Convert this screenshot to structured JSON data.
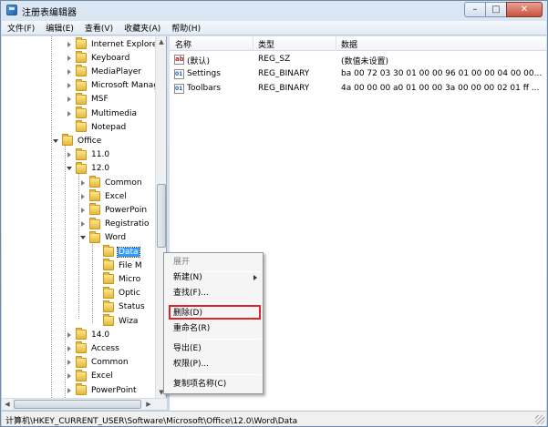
{
  "window": {
    "title": "注册表编辑器",
    "controls": {
      "minimize": "–",
      "maximize": "□",
      "close": "✕"
    }
  },
  "menubar": [
    "文件(F)",
    "编辑(E)",
    "查看(V)",
    "收藏夹(A)",
    "帮助(H)"
  ],
  "tree": {
    "rows": [
      {
        "label": "Internet Explorer",
        "twisty": "closed"
      },
      {
        "label": "Keyboard",
        "twisty": "closed"
      },
      {
        "label": "MediaPlayer",
        "twisty": "closed"
      },
      {
        "label": "Microsoft Manag",
        "twisty": "closed"
      },
      {
        "label": "MSF",
        "twisty": "closed"
      },
      {
        "label": "Multimedia",
        "twisty": "closed"
      },
      {
        "label": "Notepad",
        "twisty": "none"
      },
      {
        "label": "Office",
        "twisty": "open"
      },
      {
        "label": "11.0",
        "twisty": "closed"
      },
      {
        "label": "12.0",
        "twisty": "open"
      },
      {
        "label": "Common",
        "twisty": "closed"
      },
      {
        "label": "Excel",
        "twisty": "closed"
      },
      {
        "label": "PowerPoin",
        "twisty": "closed"
      },
      {
        "label": "Registratio",
        "twisty": "closed"
      },
      {
        "label": "Word",
        "twisty": "open"
      },
      {
        "label": "Data",
        "twisty": "none",
        "selected": true
      },
      {
        "label": "File M",
        "twisty": "none"
      },
      {
        "label": "Micro",
        "twisty": "none"
      },
      {
        "label": "Optic",
        "twisty": "none"
      },
      {
        "label": "Status",
        "twisty": "none"
      },
      {
        "label": "Wiza",
        "twisty": "none"
      },
      {
        "label": "14.0",
        "twisty": "closed"
      },
      {
        "label": "Access",
        "twisty": "closed"
      },
      {
        "label": "Common",
        "twisty": "closed"
      },
      {
        "label": "Excel",
        "twisty": "closed"
      },
      {
        "label": "PowerPoint",
        "twisty": "closed"
      }
    ]
  },
  "list": {
    "columns": [
      "名称",
      "类型",
      "数据"
    ],
    "rows": [
      {
        "icon": "ab",
        "name": "(默认)",
        "type": "REG_SZ",
        "data": "(数值未设置)"
      },
      {
        "icon": "bin",
        "name": "Settings",
        "type": "REG_BINARY",
        "data": "ba 00 72 03 30 01 00 00 96 01 00 00 04 00 00..."
      },
      {
        "icon": "bin",
        "name": "Toolbars",
        "type": "REG_BINARY",
        "data": "4a 00 00 00 a0 01 00 00 3a 00 00 00 02 01 ff ..."
      }
    ]
  },
  "context_menu": {
    "items": [
      {
        "label": "展开",
        "disabled": true
      },
      {
        "label": "新建(N)",
        "submenu": true
      },
      {
        "label": "查找(F)..."
      },
      {
        "label": "删除(D)",
        "highlighted": true
      },
      {
        "label": "重命名(R)"
      },
      {
        "label": "导出(E)"
      },
      {
        "label": "权限(P)..."
      },
      {
        "label": "复制项名称(C)"
      }
    ],
    "highlight_color": "#e0242a"
  },
  "statusbar": {
    "path": "计算机\\HKEY_CURRENT_USER\\Software\\Microsoft\\Office\\12.0\\Word\\Data"
  }
}
